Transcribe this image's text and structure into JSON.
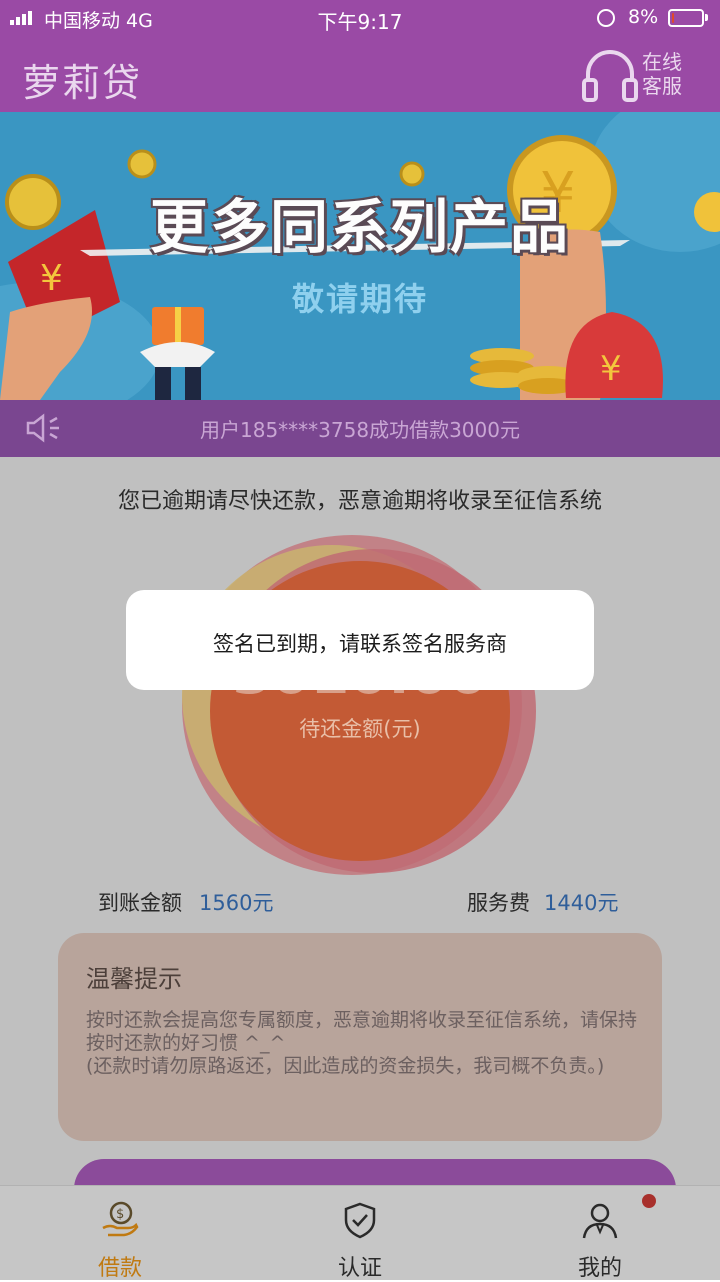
{
  "status_bar": {
    "carrier": "中国移动   4G",
    "time": "下午9:17",
    "battery_pct": "8%",
    "battery_level": 0.08
  },
  "header": {
    "title": "萝莉贷",
    "service_label_line1": "在线",
    "service_label_line2": "客服"
  },
  "banner": {
    "title": "更多同系列产品",
    "subtitle": "敬请期待"
  },
  "marquee": {
    "text": "用户185****3758成功借款3000元"
  },
  "main": {
    "warning": "您已逾期请尽快还款，恶意逾期将收录至征信系统",
    "amount_value": "3010.00",
    "amount_label": "待还金额(元)",
    "arrive_label": "到账金额",
    "arrive_value": "1560元",
    "fee_label": "服务费",
    "fee_value": "1440元",
    "tips_title": "温馨提示",
    "tips_line1": "按时还款会提高您专属额度，恶意逾期将收录至征信系统，请保持按时还款的好习惯 ^_^",
    "tips_line2": "(还款时请勿原路返还，因此造成的资金损失，我司概不负责。)"
  },
  "dialog": {
    "message": "签名已到期，请联系签名服务商"
  },
  "tabs": [
    {
      "label": "借款",
      "icon": "loan-icon",
      "active": true
    },
    {
      "label": "认证",
      "icon": "shield-check-icon",
      "active": false
    },
    {
      "label": "我的",
      "icon": "user-icon",
      "active": false
    }
  ],
  "colors": {
    "brand_purple": "#9a4aa5",
    "active_tab": "#c07a12",
    "value_blue": "#2f5e9a"
  }
}
